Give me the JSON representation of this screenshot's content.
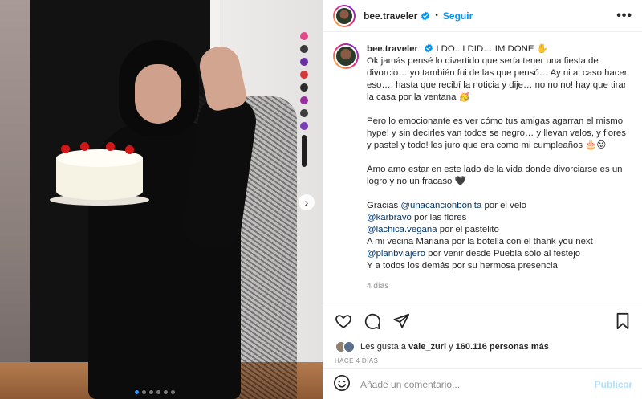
{
  "post": {
    "username": "bee.traveler",
    "follow_label": "Seguir",
    "more_label": "•••",
    "separator": "•",
    "icons": {
      "verified": "verified-badge-icon",
      "like": "heart-icon",
      "comment": "comment-icon",
      "share": "send-icon",
      "save": "bookmark-icon",
      "emoji": "emoji-icon",
      "next": "chevron-right-icon"
    },
    "carousel": {
      "slides": 6,
      "current": 1,
      "next_glyph": "›"
    }
  },
  "caption": {
    "username": "bee.traveler",
    "line1": "I DO.. I DID… IM DONE ✋",
    "para1": "Ok jamás pensé lo divertido que sería tener una fiesta de divorcio… yo también fui de las que pensó… Ay ni al caso hacer eso…. hasta que recibí la noticia y dije… no no no! hay que tirar la casa por la ventana 🥳",
    "para2": "Pero lo emocionante es ver cómo tus amigas agarran el mismo hype! y sin decirles van todos se negro… y llevan velos, y flores y pastel y todo! les juro que era como mi cumpleaños 🎂😜",
    "para3": "Amo amo estar en este lado de la vida donde divorciarse es un logro y no un fracaso 🖤",
    "thanks": [
      {
        "prefix": "Gracias ",
        "mention": "@unacancionbonita",
        "suffix": " por el velo"
      },
      {
        "prefix": "",
        "mention": "@karbravo",
        "suffix": " por las flores"
      },
      {
        "prefix": "",
        "mention": "@lachica.vegana",
        "suffix": " por el pastelito"
      },
      {
        "prefix": "A mi vecina Mariana por la botella con el thank you next",
        "mention": "",
        "suffix": ""
      },
      {
        "prefix": "",
        "mention": "@planbviajero",
        "suffix": " por venir desde Puebla sólo al festejo"
      },
      {
        "prefix": "Y a todos los demás por su hermosa presencia",
        "mention": "",
        "suffix": ""
      }
    ],
    "time_ago": "4 días"
  },
  "likes": {
    "prefix": "Les gusta a ",
    "user": "vale_zuri",
    "middle": " y ",
    "count": "160.116 personas más"
  },
  "date_label": "HACE 4 DÍAS",
  "comment_box": {
    "placeholder": "Añade un comentario...",
    "publish_label": "Publicar"
  },
  "colors": {
    "accent": "#0095f6",
    "mention": "#00376b",
    "muted": "#8e8e8e",
    "publish_disabled": "#b2dffc"
  }
}
